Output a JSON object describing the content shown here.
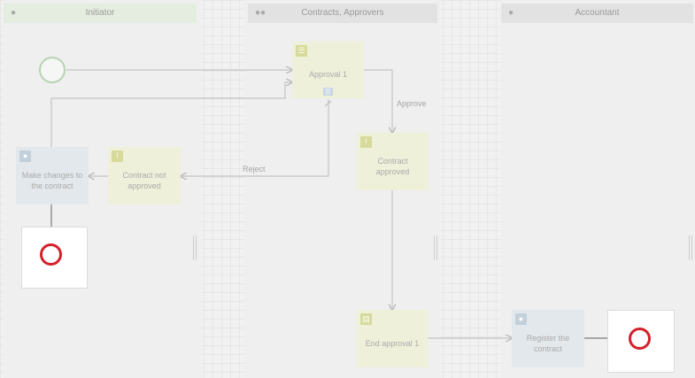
{
  "lanes": [
    {
      "name": "Initiator",
      "icon": "user-icon"
    },
    {
      "name": "Contracts, Approvers",
      "icon": "users-icon"
    },
    {
      "name": "Accountant",
      "icon": "user-icon"
    }
  ],
  "tasks": {
    "approval_1": "Approval 1",
    "contract_approved": "Contract approved",
    "contract_not_approved": "Contract not approved",
    "make_changes": "Make changes to the contract",
    "end_approval_1": "End approval 1",
    "register_contract": "Register the contract"
  },
  "flow_labels": {
    "approve": "Approve",
    "reject": "Reject"
  },
  "colors": {
    "end_event": "#d4202a",
    "start_event": "#b8d3b3",
    "approval_task": "#eef0d9",
    "user_task": "#e3e8ec"
  }
}
